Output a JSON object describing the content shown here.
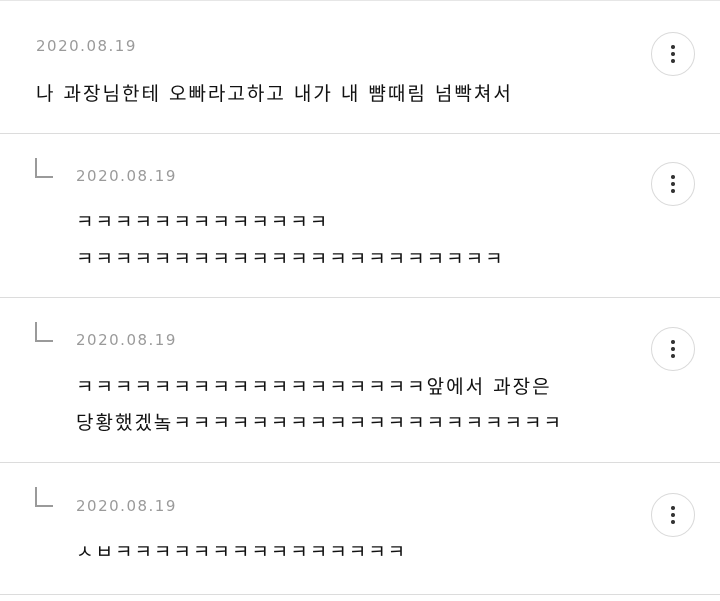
{
  "comments": [
    {
      "date": "2020.08.19",
      "lines": [
        "나 과장님한테 오빠라고하고 내가 내 뺨때림 넘빡쳐서"
      ],
      "more_icon": "more-vertical-icon"
    },
    {
      "date": "2020.08.19",
      "reply_icon": "reply-corner-icon",
      "lines": [
        "ㅋㅋㅋㅋㅋㅋㅋㅋㅋㅋㅋㅋㅋ",
        "ㅋㅋㅋㅋㅋㅋㅋㅋㅋㅋㅋㅋㅋㅋㅋㅋㅋㅋㅋㅋㅋㅋ"
      ],
      "more_icon": "more-vertical-icon"
    },
    {
      "date": "2020.08.19",
      "reply_icon": "reply-corner-icon",
      "lines": [
        "ㅋㅋㅋㅋㅋㅋㅋㅋㅋㅋㅋㅋㅋㅋㅋㅋㅋㅋ앞에서 과장은",
        "당황했겠놐ㅋㅋㅋㅋㅋㅋㅋㅋㅋㅋㅋㅋㅋㅋㅋㅋㅋㅋㅋㅋ"
      ],
      "more_icon": "more-vertical-icon"
    },
    {
      "date": "2020.08.19",
      "reply_icon": "reply-corner-icon",
      "lines": [
        "ㅅㅂㅋㅋㅋㅋㅋㅋㅋㅋㅋㅋㅋㅋㅋㅋㅋ"
      ],
      "more_icon": "more-vertical-icon"
    }
  ]
}
